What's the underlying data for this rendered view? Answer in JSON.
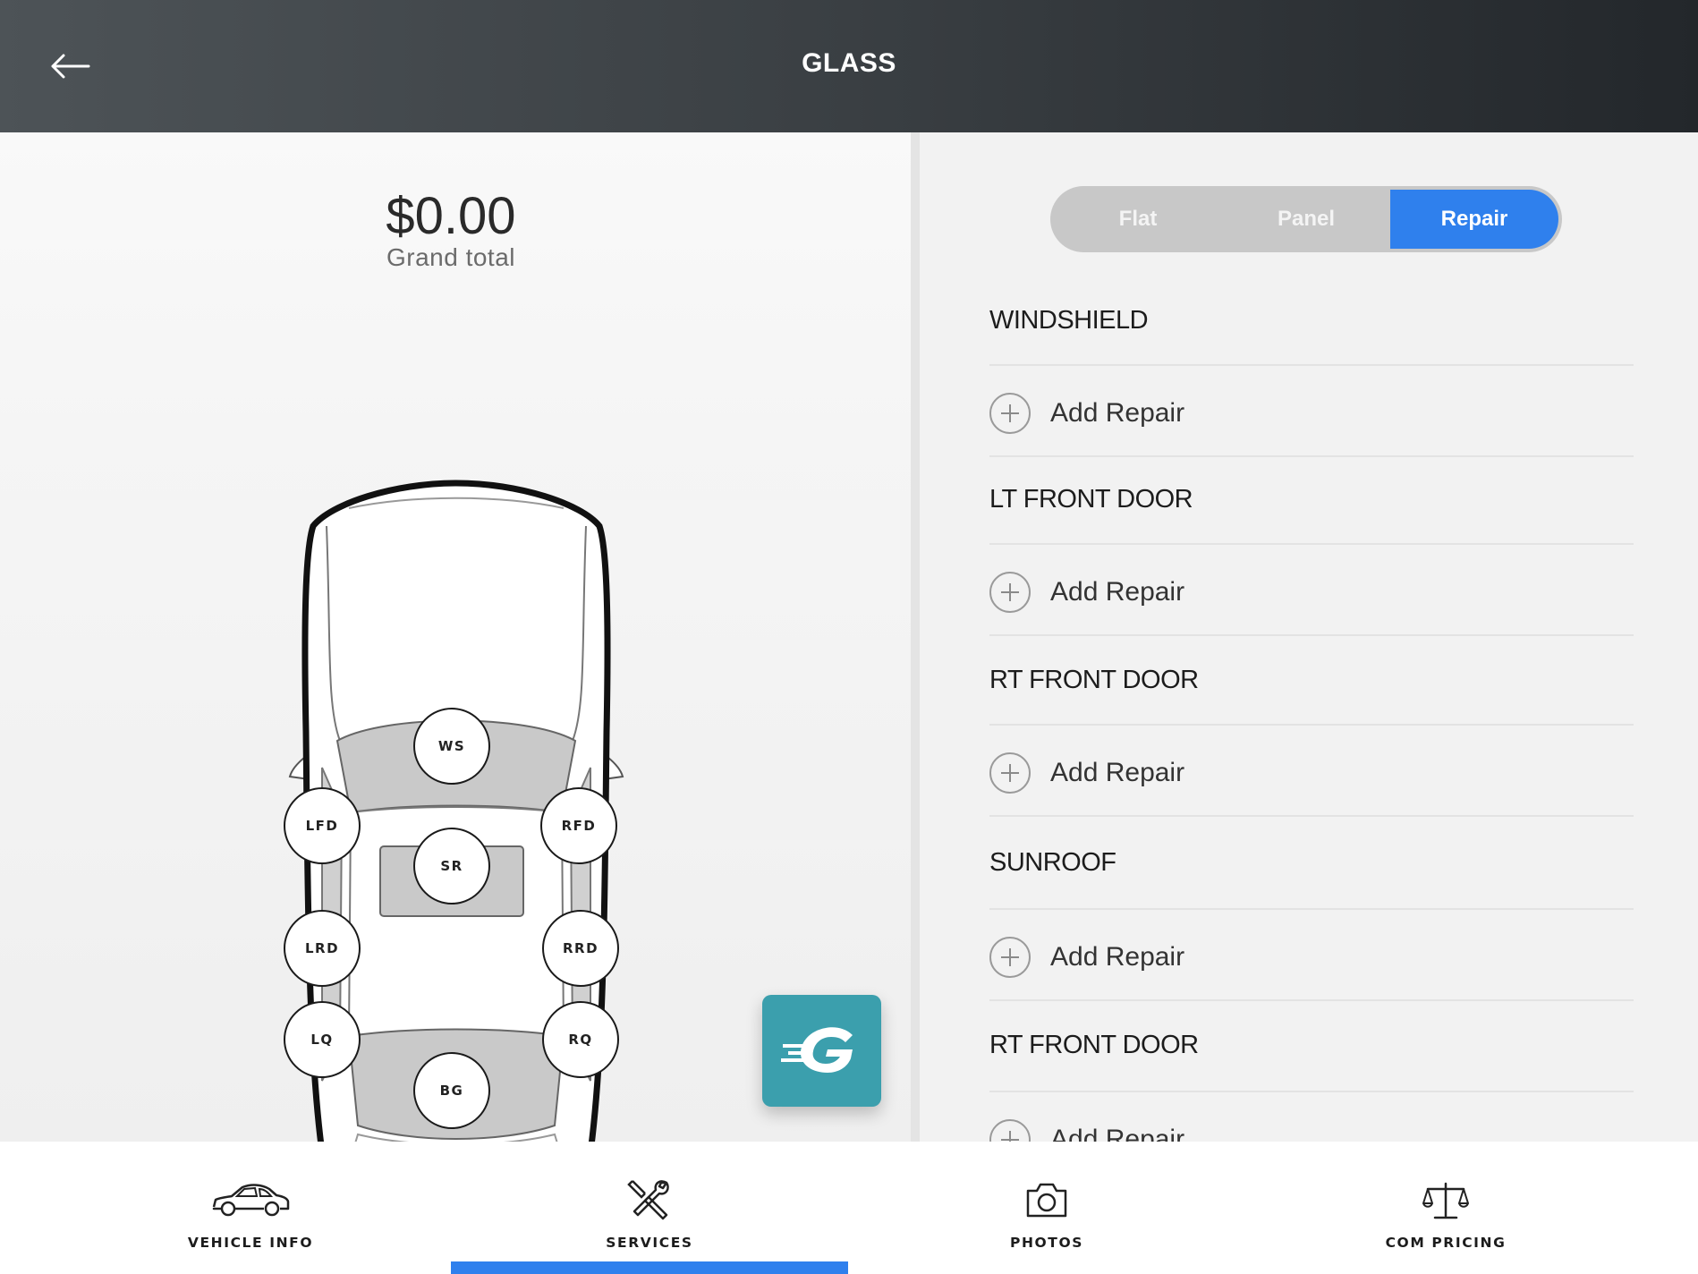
{
  "header": {
    "title": "GLASS",
    "back_icon": "arrow-left-icon"
  },
  "summary": {
    "amount": "$0.00",
    "label": "Grand total"
  },
  "car_diagram": {
    "spots": [
      "WS",
      "SR",
      "LFD",
      "RFD",
      "LRD",
      "RRD",
      "LQ",
      "RQ",
      "BG"
    ]
  },
  "fab": {
    "icon": "brand-g-logo-icon",
    "color": "#3b9fad"
  },
  "mode_toggle": {
    "options": [
      "Flat",
      "Panel",
      "Repair"
    ],
    "selected": "Repair",
    "accent": "#2f80ed"
  },
  "sections": [
    {
      "title": "WINDSHIELD",
      "action": "Add Repair"
    },
    {
      "title": "LT FRONT DOOR",
      "action": "Add Repair"
    },
    {
      "title": "RT FRONT DOOR",
      "action": "Add Repair"
    },
    {
      "title": "SUNROOF",
      "action": "Add Repair"
    },
    {
      "title": "RT FRONT DOOR",
      "action": "Add Repair"
    }
  ],
  "bottom_nav": {
    "items": [
      {
        "label": "VEHICLE INFO",
        "icon": "car-icon"
      },
      {
        "label": "SERVICES",
        "icon": "tools-icon"
      },
      {
        "label": "PHOTOS",
        "icon": "camera-icon"
      },
      {
        "label": "COM PRICING",
        "icon": "scale-icon"
      }
    ],
    "active": "SERVICES"
  }
}
